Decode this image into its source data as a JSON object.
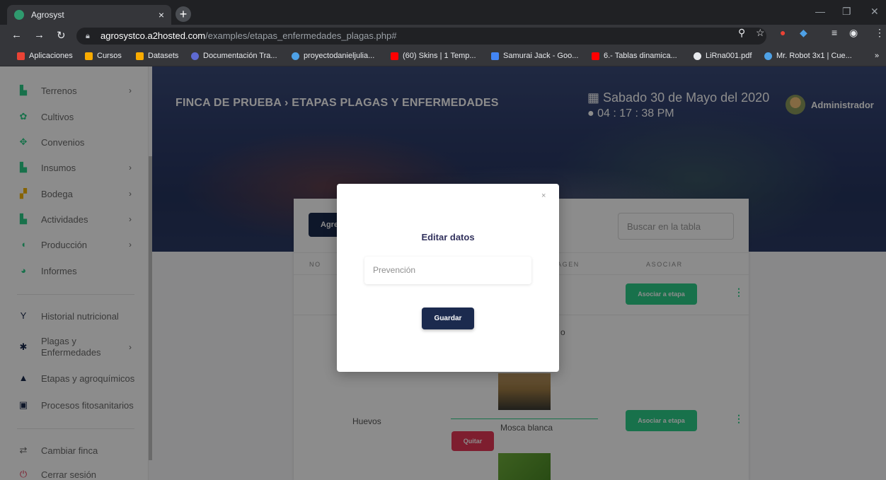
{
  "browser": {
    "tab_title": "Agrosyst",
    "tab_close": "×",
    "new_tab": "+",
    "url_host": "agrosystco.a2hosted.com",
    "url_path": "/examples/etapas_enfermedades_plagas.php#",
    "bookmarks": [
      {
        "label": "Aplicaciones",
        "color": "#ea4335"
      },
      {
        "label": "Cursos",
        "color": "#f9ab00"
      },
      {
        "label": "Datasets",
        "color": "#f9ab00"
      },
      {
        "label": "Documentación Tra...",
        "color": "#5e6ad2"
      },
      {
        "label": "proyectodanieljulia...",
        "color": "#4ea1e6"
      },
      {
        "label": "(60) Skins | 1 Temp...",
        "color": "#ff0000"
      },
      {
        "label": "Samurai Jack - Goo...",
        "color": "#4285f4"
      },
      {
        "label": "6.- Tablas dinamica...",
        "color": "#ff0000"
      },
      {
        "label": "LiRna001.pdf",
        "color": "#e8eaed"
      },
      {
        "label": "Mr. Robot 3x1 | Cue...",
        "color": "#4ea1e6"
      }
    ],
    "more": "»"
  },
  "sidebar": {
    "items": [
      {
        "label": "Terrenos",
        "icon": "map-icon",
        "glyph": "▙",
        "color": "#2dce89",
        "chev": "›"
      },
      {
        "label": "Cultivos",
        "icon": "plant-icon",
        "glyph": "✿",
        "color": "#2dce89",
        "chev": ""
      },
      {
        "label": "Convenios",
        "icon": "handshake-icon",
        "glyph": "✥",
        "color": "#2dce89",
        "chev": ""
      },
      {
        "label": "Insumos",
        "icon": "map-icon",
        "glyph": "▙",
        "color": "#2dce89",
        "chev": "›"
      },
      {
        "label": "Bodega",
        "icon": "boxes-icon",
        "glyph": "▞",
        "color": "#f4b400",
        "chev": "›"
      },
      {
        "label": "Actividades",
        "icon": "map-icon",
        "glyph": "▙",
        "color": "#2dce89",
        "chev": "›"
      },
      {
        "label": "Producción",
        "icon": "leaf-icon",
        "glyph": "◖",
        "color": "#2dce89",
        "chev": "›"
      },
      {
        "label": "Informes",
        "icon": "chart-pie-icon",
        "glyph": "◕",
        "color": "#2dce89",
        "chev": ""
      },
      {
        "label": "Historial nutricional",
        "icon": "seedling-icon",
        "glyph": "Y",
        "color": "#1b2a4e",
        "chev": ""
      },
      {
        "label": "Plagas y",
        "label2": "Enfermedades",
        "icon": "bug-icon",
        "glyph": "✱",
        "color": "#1b2a4e",
        "chev": "›"
      },
      {
        "label": "Etapas y agroquímicos",
        "icon": "warning-icon",
        "glyph": "▲",
        "color": "#1b2a4e",
        "chev": ""
      },
      {
        "label": "Procesos fitosanitarios",
        "icon": "first-aid-icon",
        "glyph": "▣",
        "color": "#1b2a4e",
        "chev": ""
      },
      {
        "label": "Cambiar finca",
        "icon": "exchange-icon",
        "glyph": "⇄",
        "color": "#6b6b6b",
        "chev": ""
      },
      {
        "label": "Cerrar sesión",
        "icon": "power-icon",
        "glyph": "⏻",
        "color": "#e63757",
        "chev": ""
      }
    ]
  },
  "header": {
    "breadcrumb": "FINCA DE PRUEBA › ETAPAS PLAGAS Y ENFERMEDADES",
    "date": "Sabado 30 de Mayo del 2020",
    "time": "04 : 17 : 38 PM",
    "user": "Administrador"
  },
  "card": {
    "add_button": "Agre",
    "search_placeholder": "Buscar en la tabla",
    "columns": [
      "NO",
      "AGEN",
      "ASOCIAR"
    ],
    "rows": [
      {
        "action": "Asociar a etapa",
        "menu": "⋮"
      },
      {
        "partial": "o"
      },
      {
        "name": "Huevos",
        "pest": "Mosca blanca",
        "remove": "Quitar",
        "action": "Asociar a etapa",
        "menu": "⋮"
      }
    ]
  },
  "modal": {
    "close": "×",
    "title": "Editar datos",
    "input_placeholder": "Prevención",
    "save": "Guardar"
  }
}
